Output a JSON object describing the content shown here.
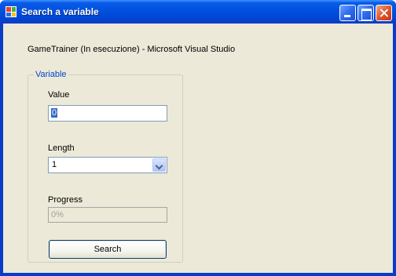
{
  "window": {
    "title": "Search a variable",
    "controls": {
      "minimize": "minimize",
      "maximize": "maximize",
      "close": "close"
    }
  },
  "caption": "GameTrainer (In esecuzione) - Microsoft Visual Studio",
  "group": {
    "legend": "Variable",
    "value_label": "Value",
    "value_input": "0",
    "length_label": "Length",
    "length_selected": "1",
    "progress_label": "Progress",
    "progress_value": "0%",
    "search_button": "Search"
  },
  "colors": {
    "titlebar": "#0053e0",
    "client_bg": "#ece9d8",
    "legend_text": "#0046d5",
    "selection": "#316ac5"
  },
  "icons": [
    "app-icon",
    "minimize-icon",
    "maximize-icon",
    "close-icon",
    "chevron-down-icon"
  ]
}
